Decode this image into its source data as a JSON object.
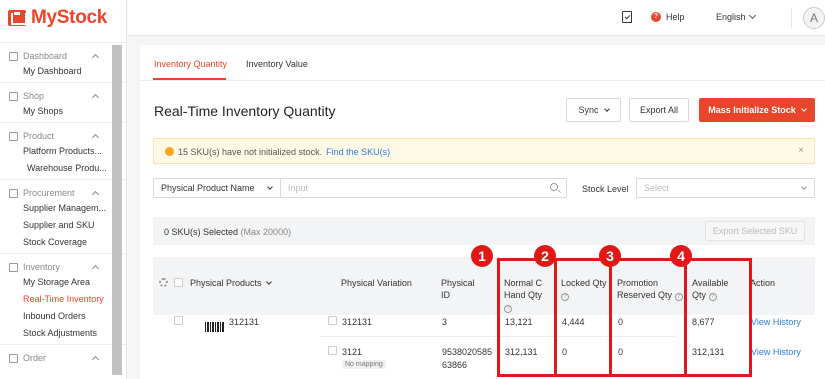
{
  "app": {
    "name": "MyStock"
  },
  "topbar": {
    "help": "Help",
    "language": "English",
    "avatar_letter": "A"
  },
  "sidebar": {
    "sections": [
      {
        "title": "Dashboard",
        "items": [
          "My Dashboard"
        ]
      },
      {
        "title": "Shop",
        "items": [
          "My Shops"
        ]
      },
      {
        "title": "Product",
        "items": [
          "Platform Products...",
          "Warehouse Produ..."
        ]
      },
      {
        "title": "Procurement",
        "items": [
          "Supplier Managem...",
          "Supplier and SKU",
          "Stock Coverage"
        ]
      },
      {
        "title": "Inventory",
        "items": [
          "My Storage Area",
          "Real-Time Inventory",
          "Inbound Orders",
          "Stock Adjustments"
        ]
      },
      {
        "title": "Order",
        "items": []
      }
    ],
    "active_item": "Real-Time Inventory"
  },
  "tabs": [
    "Inventory Quantity",
    "Inventory Value"
  ],
  "page": {
    "title": "Real-Time Inventory Quantity",
    "sync": "Sync",
    "export_all": "Export All",
    "mass_init": "Mass Initialize Stock"
  },
  "alert": {
    "text": "15 SKU(s) have not initialized stock.",
    "link": "Find the SKU(s)",
    "close": "×"
  },
  "filters": {
    "field": "Physical Product Name",
    "input_placeholder": "Input",
    "stock_level_label": "Stock Level",
    "stock_level_placeholder": "Select"
  },
  "selection": {
    "count_text": "0 SKU(s) Selected",
    "max_text": "(Max 20000)",
    "export_selected": "Export Selected SKU"
  },
  "table": {
    "headers": {
      "physical_products": "Physical Products",
      "physical_variation": "Physical Variation",
      "physical_id": [
        "Physical",
        "ID"
      ],
      "normal_onhand": [
        "Normal C",
        "Hand Qty"
      ],
      "locked": "Locked Qty",
      "promotion": [
        "Promotion",
        "Reserved Qty"
      ],
      "available": [
        "Available",
        "Qty"
      ],
      "action": "Action"
    },
    "rows": [
      {
        "product": "312131",
        "variation": "312131",
        "id": "3",
        "onhand": "13,121",
        "locked": "4,444",
        "promo": "0",
        "available": "8,677",
        "action": "View History"
      },
      {
        "product": "",
        "variation": "3121",
        "mapping": "No mapping",
        "id": [
          "9538020585",
          "63866"
        ],
        "onhand": "312,131",
        "locked": "0",
        "promo": "0",
        "available": "312,131",
        "action": "View History"
      }
    ]
  },
  "annotations": [
    "1",
    "2",
    "3",
    "4"
  ],
  "colors": {
    "brand": "#e8452c",
    "link": "#2f7de1",
    "annotation": "#e01818"
  }
}
